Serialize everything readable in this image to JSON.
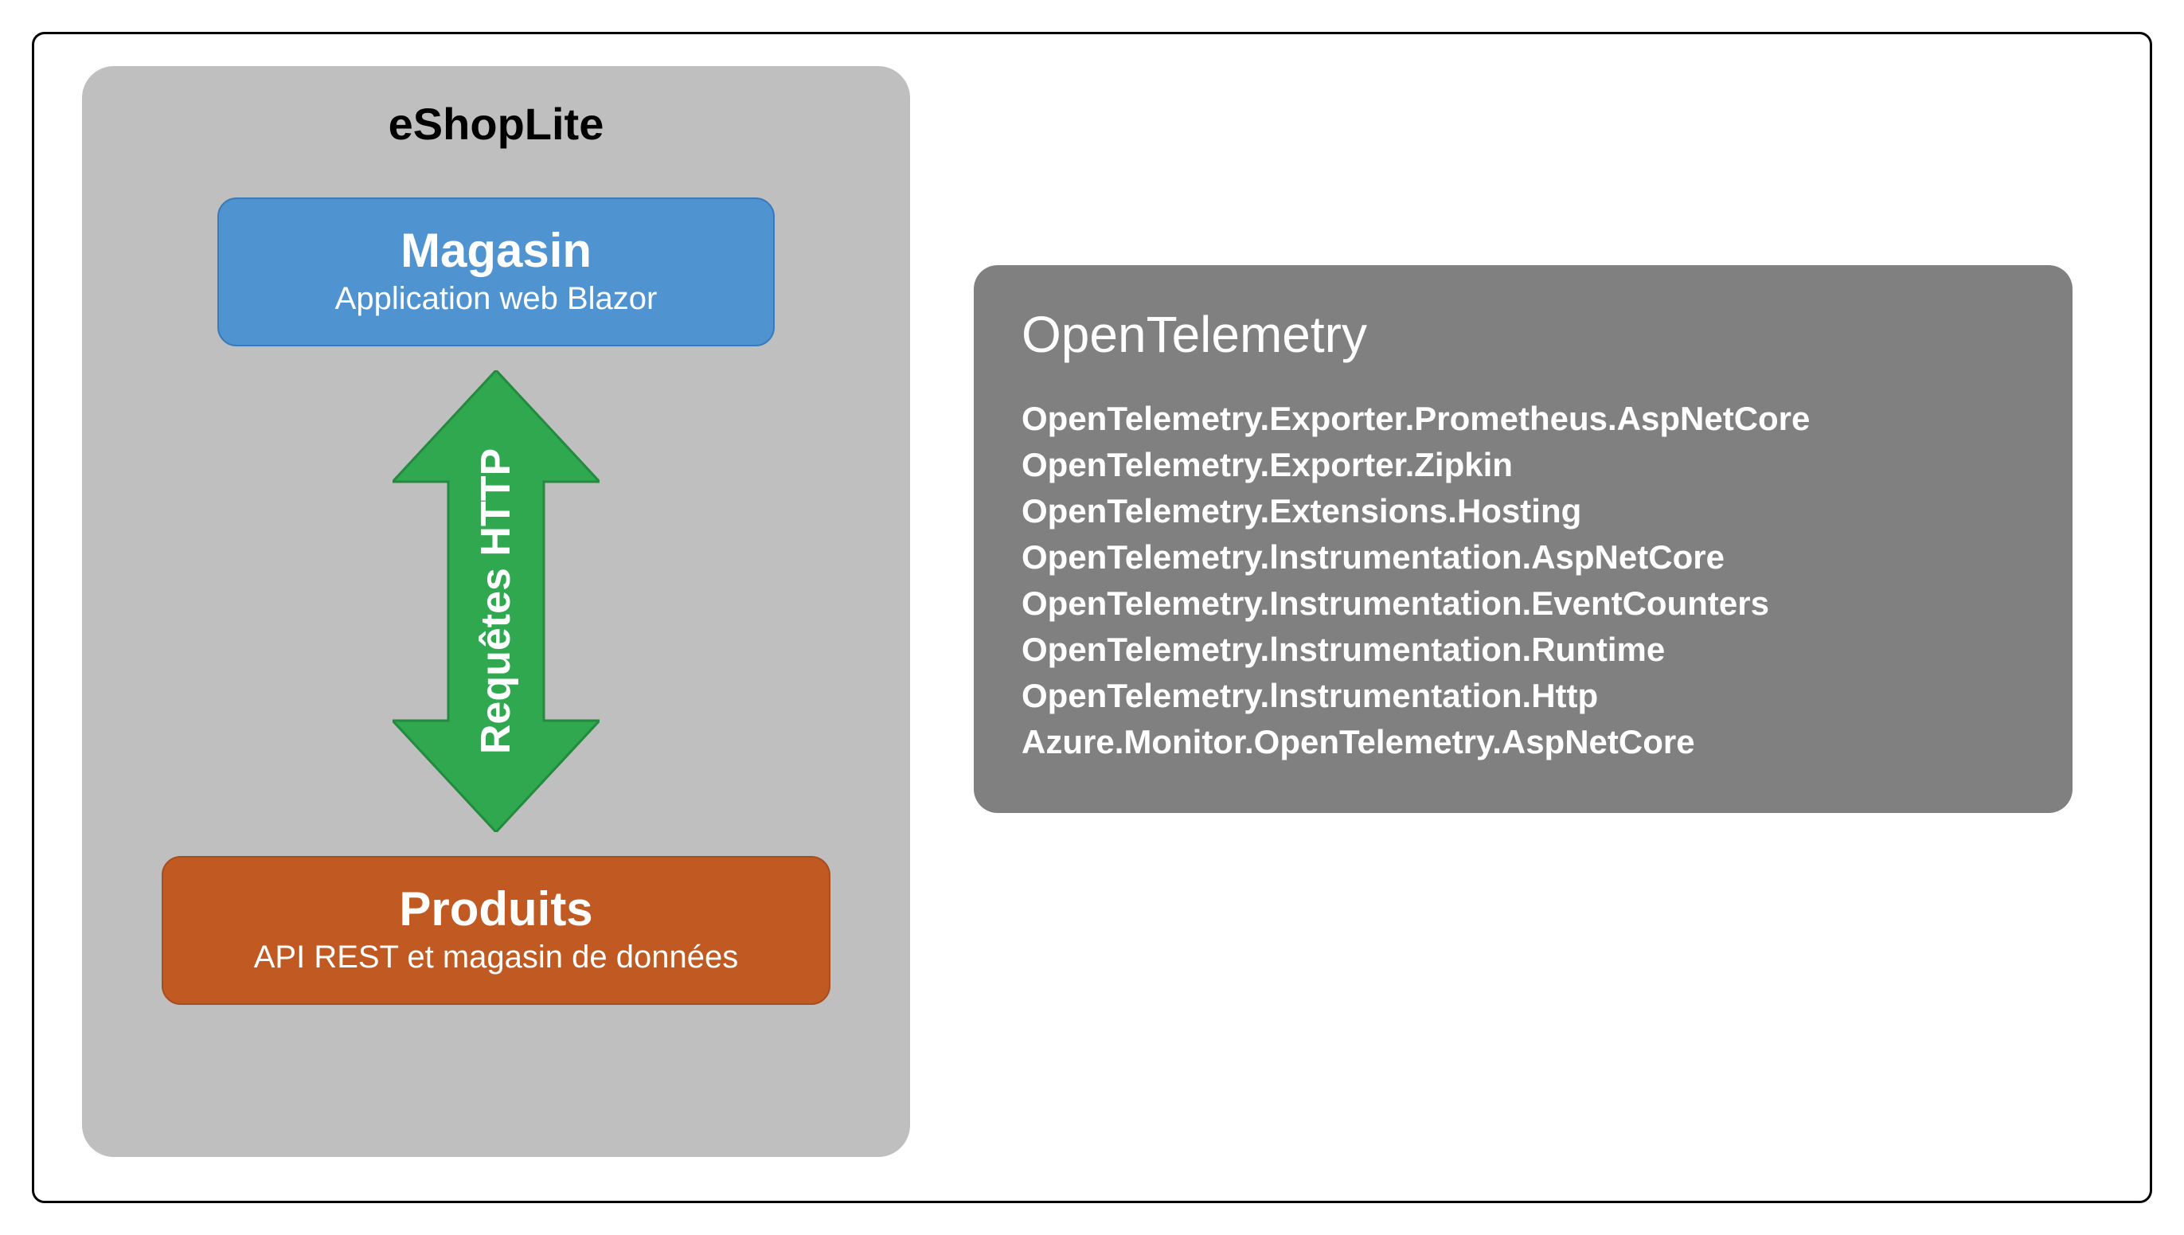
{
  "left": {
    "title": "eShopLite",
    "top_box": {
      "title": "Magasin",
      "sub": "Application web Blazor"
    },
    "arrow_label": "Requêtes HTTP",
    "bottom_box": {
      "title": "Produits",
      "sub": "API REST et magasin de données"
    }
  },
  "right": {
    "title": "OpenTelemetry",
    "items": [
      "OpenTelemetry.Exporter.Prometheus.AspNetCore",
      "OpenTelemetry.Exporter.Zipkin",
      "OpenTelemetry.Extensions.Hosting",
      "OpenTelemetry.lnstrumentation.AspNetCore",
      "OpenTeIemetry.Instrumentation.EventCounters",
      "OpenTelemetry.lnstrumentation.Runtime",
      "OpenTelemetry.lnstrumentation.Http",
      "Azure.Monitor.OpenTelemetry.AspNetCore"
    ]
  }
}
